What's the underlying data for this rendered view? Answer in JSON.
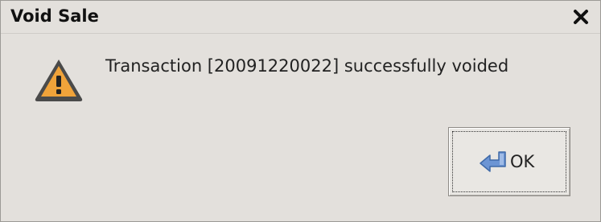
{
  "window": {
    "title": "Void Sale",
    "close_icon": "close-icon"
  },
  "dialog": {
    "icon": "warning-icon",
    "message": "Transaction [20091220022] successfully voided"
  },
  "buttons": {
    "ok_label": "OK",
    "ok_icon": "enter-arrow-icon"
  },
  "colors": {
    "warning_fill": "#f0a33a",
    "warning_border": "#4a4a4a",
    "ok_icon_blue": "#5b86c7"
  }
}
